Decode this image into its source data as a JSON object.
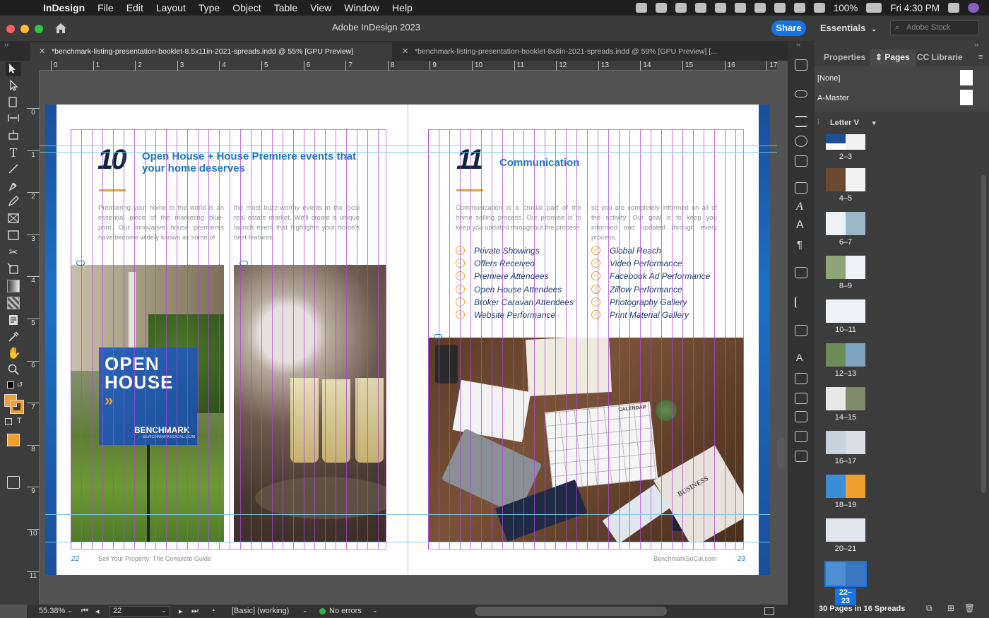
{
  "menubar": {
    "app": "InDesign",
    "items": [
      "File",
      "Edit",
      "Layout",
      "Type",
      "Object",
      "Table",
      "View",
      "Window",
      "Help"
    ],
    "battery": "100%",
    "clock": "Fri 4:30 PM"
  },
  "titlebar": {
    "title": "Adobe InDesign 2023",
    "share": "Share",
    "workspace": "Essentials",
    "search_placeholder": "Adobe Stock"
  },
  "tabs": [
    {
      "label": "*benchmark-listing-presentation-booklet-8.5x11in-2021-spreads.indd @ 55% [GPU Preview]"
    },
    {
      "label": "*benchmark-listing-presentation-booklet-8x8in-2021-spreads.indd @ 59% [GPU Preview] [..."
    }
  ],
  "ruler": {
    "h": [
      "0",
      "1",
      "2",
      "3",
      "4",
      "5",
      "6",
      "7",
      "8",
      "9",
      "10",
      "11",
      "12",
      "13",
      "14",
      "15",
      "16",
      "17"
    ],
    "v": [
      "0",
      "1",
      "2",
      "3",
      "4",
      "5",
      "6",
      "7",
      "8",
      "9",
      "10",
      "11"
    ]
  },
  "left_page": {
    "number": "10",
    "title": "Open House + House Premiere events that your home deserves",
    "body_col1": "Premiering your home to the world is an essential piece of the marketing blue-print. Our innovative house premieres have become widely known as some of",
    "body_col2": "the most buzz-worthy events in the local real estate market. We'll create a unique launch event that highlights your home's best features.",
    "sign_line1": "OPEN",
    "sign_line2": "HOUSE",
    "sign_brand": "BENCHMARK",
    "sign_url": "BENCHMARKSOCAL.COM",
    "footer_num": "22",
    "footer_text": "Sell Your Property: The Complete Guide"
  },
  "right_page": {
    "number": "11",
    "title": "Communication",
    "body_col1": "Communication is a crucial part of the home selling process. Our promise is to keep you updated throughout the process",
    "body_col2": "so you are completely informed on all of the activity. Our goal is to keep you informed and updated through every process.",
    "checklist_col1": [
      "Private Showings",
      "Offers Received",
      "Premiere Attendees",
      "Open House Attendees",
      "Broker Caravan Attendees",
      "Website Performance"
    ],
    "checklist_col2": [
      "Global Reach",
      "Video Performance",
      "Facebook Ad Performance",
      "Zillow Performance",
      "Photography Gallery",
      "Print Material Gallery"
    ],
    "calendar_label": "CALENDAR",
    "business_label": "BUSINESS",
    "footer_url": "BenchmarkSoCal.com",
    "footer_num": "23"
  },
  "panel": {
    "tabs": [
      "Properties",
      "Pages",
      "CC Librarie"
    ],
    "masters": [
      "[None]",
      "A-Master"
    ],
    "size_label": "Letter V",
    "spreads": [
      "2–3",
      "4–5",
      "6–7",
      "8–9",
      "10–11",
      "12–13",
      "14–15",
      "16–17",
      "18–19",
      "20–21",
      "22–23"
    ],
    "selected_spread": "22–23",
    "summary": "30 Pages in 16 Spreads"
  },
  "status": {
    "zoom": "55.38%",
    "page": "22",
    "profile": "[Basic] (working)",
    "errors": "No errors"
  },
  "colors": {
    "accent_blue": "#1473e6",
    "title_blue": "#1f75c4",
    "orange": "#f0a02e",
    "navy": "#13233f"
  }
}
